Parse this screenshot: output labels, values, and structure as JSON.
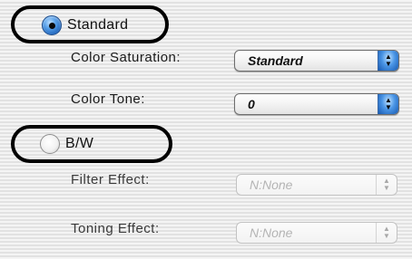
{
  "standard": {
    "label": "Standard",
    "selected": true
  },
  "bw": {
    "label": "B/W",
    "selected": false
  },
  "color_saturation": {
    "label": "Color Saturation:",
    "value": "Standard"
  },
  "color_tone": {
    "label": "Color Tone:",
    "value": "0"
  },
  "filter_effect": {
    "label": "Filter Effect:",
    "value": "N:None",
    "enabled": false
  },
  "toning_effect": {
    "label": "Toning Effect:",
    "value": "N:None",
    "enabled": false
  },
  "icons": {
    "popup_arrows": "up-down-arrows-icon",
    "radio": "radio-button-icon"
  },
  "colors": {
    "accent": "#1a5fb8",
    "highlight_outline": "#000000"
  }
}
